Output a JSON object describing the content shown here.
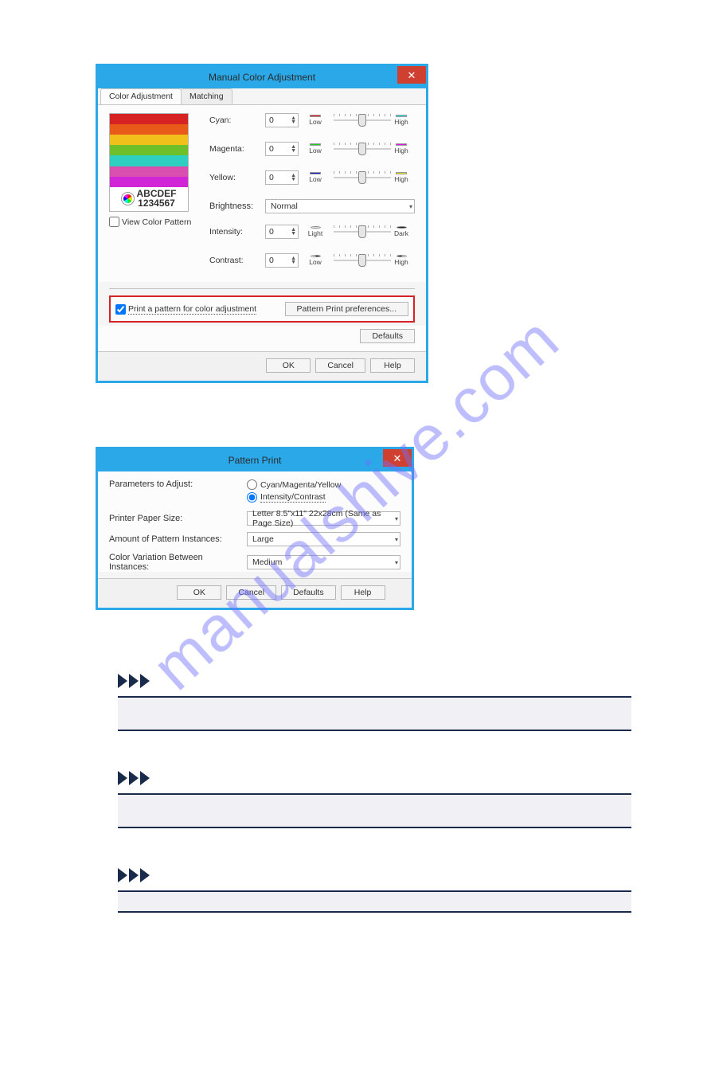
{
  "watermark": "manualshive.com",
  "dialog1": {
    "title": "Manual Color Adjustment",
    "tabs": [
      "Color Adjustment",
      "Matching"
    ],
    "preview": {
      "line1": "ABCDEF",
      "line2": "1234567"
    },
    "viewColorPattern": "View Color Pattern",
    "rows": {
      "cyan": {
        "label": "Cyan:",
        "value": "0",
        "low": "Low",
        "high": "High",
        "c1": "#e21919",
        "c2": "#19e2e2"
      },
      "magenta": {
        "label": "Magenta:",
        "value": "0",
        "low": "Low",
        "high": "High",
        "c1": "#1bcf1b",
        "c2": "#e21be2"
      },
      "yellow": {
        "label": "Yellow:",
        "value": "0",
        "low": "Low",
        "high": "High",
        "c1": "#1414c8",
        "c2": "#e2e21b"
      },
      "intensity": {
        "label": "Intensity:",
        "value": "0",
        "low": "Light",
        "high": "Dark"
      },
      "contrast": {
        "label": "Contrast:",
        "value": "0",
        "low": "Low",
        "high": "High"
      }
    },
    "brightness": {
      "label": "Brightness:",
      "value": "Normal"
    },
    "printPattern": {
      "check": "Print a pattern for color adjustment",
      "button": "Pattern Print preferences..."
    },
    "defaults": "Defaults",
    "buttons": {
      "ok": "OK",
      "cancel": "Cancel",
      "help": "Help"
    }
  },
  "dialog2": {
    "title": "Pattern Print",
    "paramsLabel": "Parameters to Adjust:",
    "radio1": "Cyan/Magenta/Yellow",
    "radio2": "Intensity/Contrast",
    "paperLabel": "Printer Paper Size:",
    "paperValue": "Letter 8.5\"x11\" 22x28cm (Same as Page Size)",
    "amountLabel": "Amount of Pattern Instances:",
    "amountValue": "Large",
    "variationLabel": "Color Variation Between Instances:",
    "variationValue": "Medium",
    "buttons": {
      "ok": "OK",
      "cancel": "Cancel",
      "defaults": "Defaults",
      "help": "Help"
    }
  }
}
